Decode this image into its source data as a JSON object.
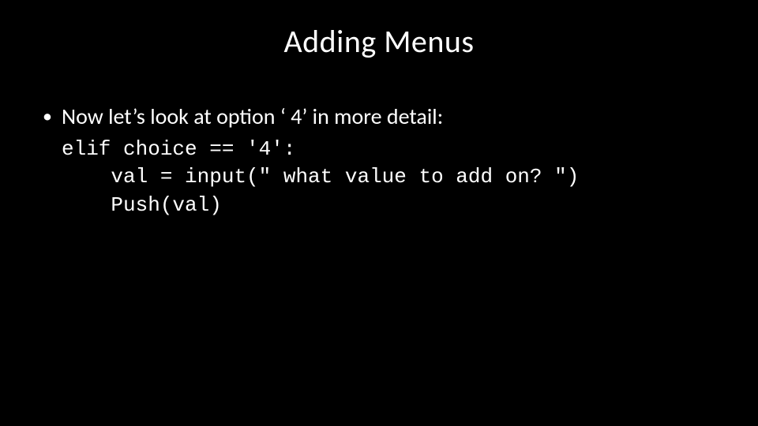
{
  "title": "Adding Menus",
  "bullet1": "Now let’s look at option ‘ 4’ in more detail:",
  "code": {
    "line1": "elif choice == '4':",
    "line2": "    val = input(\" what value to add on? \")",
    "line3": "    Push(val)"
  }
}
